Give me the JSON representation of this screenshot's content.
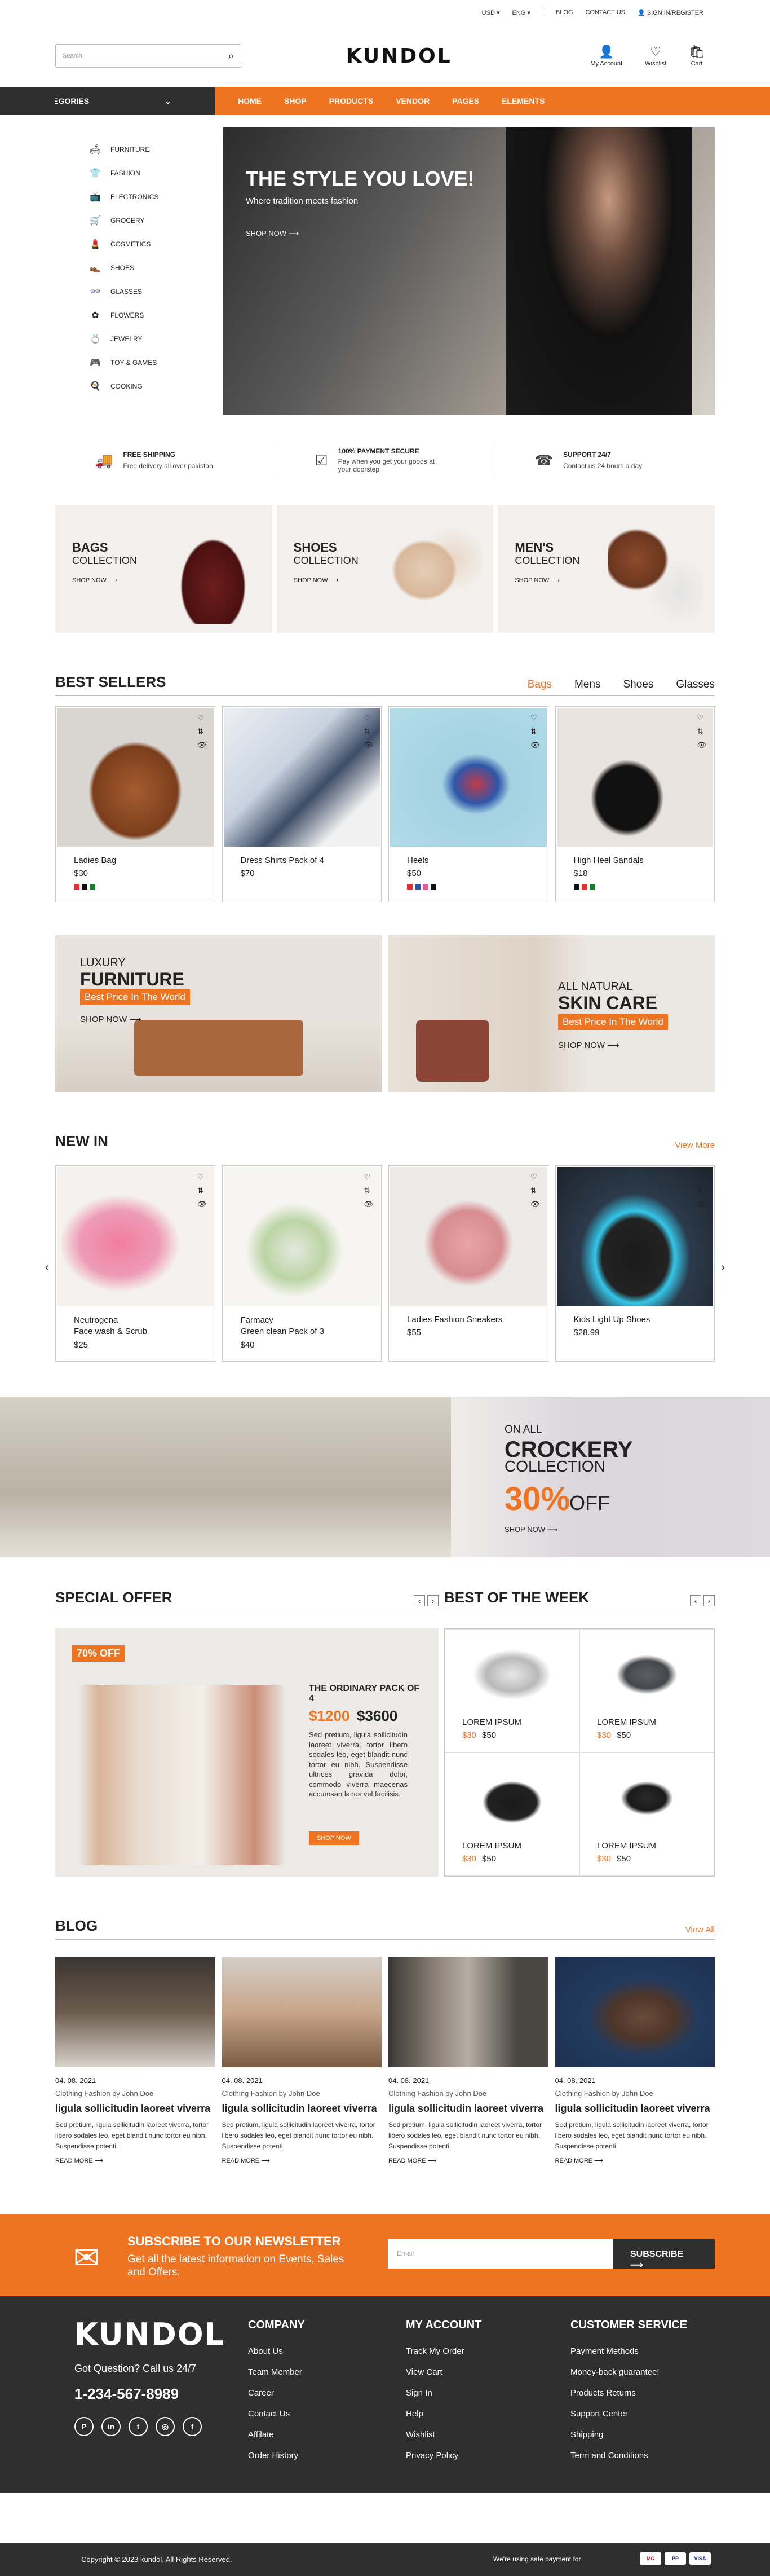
{
  "topbar": {
    "currency": "USD ▾",
    "language": "ENG ▾",
    "blog": "BLOG",
    "contact": "CONTACT US",
    "signin": "SIGN IN/REGISTER"
  },
  "header": {
    "search_placeholder": "Search",
    "logo": "KUNDOL",
    "account": "My Account",
    "wishlist": "Wishlist",
    "cart": "Cart"
  },
  "nav": {
    "categories": "CATEGORIES",
    "links": [
      "HOME",
      "SHOP",
      "PRODUCTS",
      "VENDOR",
      "PAGES",
      "ELEMENTS"
    ]
  },
  "sidebar": [
    "FURNITURE",
    "FASHION",
    "ELECTRONICS",
    "GROCERY",
    "COSMETICS",
    "SHOES",
    "GLASSES",
    "FLOWERS",
    "JEWELRY",
    "TOY & GAMES",
    "COOKING"
  ],
  "hero": {
    "title": "THE STYLE YOU LOVE!",
    "subtitle": "Where tradition meets fashion",
    "cta": "SHOP NOW ⟶"
  },
  "features": [
    {
      "title": "FREE SHIPPING",
      "text": "Free delivery all over pakistan"
    },
    {
      "title": "100% PAYMENT SECURE",
      "text": "Pay when you get your goods at your doorstep"
    },
    {
      "title": "SUPPORT 24/7",
      "text": "Contact us 24 hours a day"
    }
  ],
  "collections": [
    {
      "title": "BAGS",
      "sub": "COLLECTION",
      "cta": "SHOP NOW ⟶"
    },
    {
      "title": "SHOES",
      "sub": "COLLECTION",
      "cta": "SHOP NOW ⟶"
    },
    {
      "title": "MEN'S",
      "sub": "COLLECTION",
      "cta": "SHOP NOW ⟶"
    }
  ],
  "best_sellers": {
    "title": "BEST SELLERS",
    "tabs": [
      "Bags",
      "Mens",
      "Shoes",
      "Glasses"
    ],
    "products": [
      {
        "name": "Ladies Bag",
        "price": "$30"
      },
      {
        "name": "Dress Shirts Pack of 4",
        "price": "$70"
      },
      {
        "name": "Heels",
        "price": "$50"
      },
      {
        "name": "High Heel Sandals",
        "price": "$18"
      }
    ]
  },
  "promos": [
    {
      "line1": "LUXURY",
      "line2": "FURNITURE",
      "tag": "Best Price In The World",
      "cta": "SHOP NOW ⟶"
    },
    {
      "line1": "ALL NATURAL",
      "line2": "SKIN CARE",
      "tag": "Best Price In The World",
      "cta": "SHOP NOW ⟶"
    }
  ],
  "new_in": {
    "title": "NEW IN",
    "more": "View More",
    "products": [
      {
        "name": "Neutrogena\nFace wash & Scrub",
        "price": "$25"
      },
      {
        "name": "Farmacy\nGreen clean Pack of 3",
        "price": "$40"
      },
      {
        "name": "Ladies Fashion Sneakers",
        "price": "$55"
      },
      {
        "name": "Kids Light Up Shoes",
        "price": "$28.99"
      }
    ]
  },
  "crockery": {
    "l1": "ON ALL",
    "l2": "CROCKERY",
    "l3": "COLLECTION",
    "pct": "30%",
    "off": "OFF",
    "cta": "SHOP NOW ⟶"
  },
  "special": {
    "title": "SPECIAL OFFER",
    "badge": "70% OFF",
    "name": "THE ORDINARY PACK OF 4",
    "price": "$1200",
    "old": "$3600",
    "desc": "Sed pretium, ligula sollicitudin laoreet viverra, tortor libero sodales leo, eget blandit nunc tortor eu nibh. Suspendisse ultrices gravida dolor, commodo viverra maecenas accumsan lacus vel facilisis.",
    "cta": "SHOP NOW"
  },
  "best_week": {
    "title": "BEST OF THE WEEK",
    "items": [
      {
        "name": "LOREM IPSUM",
        "price": "$30",
        "old": "$50"
      },
      {
        "name": "LOREM IPSUM",
        "price": "$30",
        "old": "$50"
      },
      {
        "name": "LOREM IPSUM",
        "price": "$30",
        "old": "$50"
      },
      {
        "name": "LOREM IPSUM",
        "price": "$30",
        "old": "$50"
      }
    ]
  },
  "blog": {
    "title": "BLOG",
    "more": "View All",
    "posts": [
      {
        "date": "04. 08. 2021",
        "meta": "Clothing Fashion    by John Doe",
        "title": "ligula sollicitudin laoreet viverra",
        "text": "Sed pretium, ligula sollicitudin laoreet viverra, tortor libero sodales leo, eget blandit nunc tortor eu nibh. Suspendisse potenti.",
        "cta": "READ MORE ⟶"
      },
      {
        "date": "04. 08. 2021",
        "meta": "Clothing Fashion    by John Doe",
        "title": "ligula sollicitudin laoreet viverra",
        "text": "Sed pretium, ligula sollicitudin laoreet viverra, tortor libero sodales leo, eget blandit nunc tortor eu nibh. Suspendisse potenti.",
        "cta": "READ MORE ⟶"
      },
      {
        "date": "04. 08. 2021",
        "meta": "Clothing Fashion    by John Doe",
        "title": "ligula sollicitudin laoreet viverra",
        "text": "Sed pretium, ligula sollicitudin laoreet viverra, tortor libero sodales leo, eget blandit nunc tortor eu nibh. Suspendisse potenti.",
        "cta": "READ MORE ⟶"
      },
      {
        "date": "04. 08. 2021",
        "meta": "Clothing Fashion    by John Doe",
        "title": "ligula sollicitudin laoreet viverra",
        "text": "Sed pretium, ligula sollicitudin laoreet viverra, tortor libero sodales leo, eget blandit nunc tortor eu nibh. Suspendisse potenti.",
        "cta": "READ MORE ⟶"
      }
    ]
  },
  "newsletter": {
    "title": "SUBSCRIBE TO OUR NEWSLETTER",
    "text": "Get all the latest information on Events, Sales and Offers.",
    "placeholder": "Email",
    "button": "SUBSCRIBE ⟶"
  },
  "footer": {
    "logo": "KUNDOL",
    "question": "Got Question? Call us 24/7",
    "phone": "1-234-567-8989",
    "company": {
      "title": "COMPANY",
      "links": [
        "About Us",
        "Team Member",
        "Career",
        "Contact Us",
        "Affilate",
        "Order History"
      ]
    },
    "account": {
      "title": "MY ACCOUNT",
      "links": [
        "Track My Order",
        "View Cart",
        "Sign In",
        "Help",
        "Wishlist",
        "Privacy Policy"
      ]
    },
    "service": {
      "title": "CUSTOMER SERVICE",
      "links": [
        "Payment Methods",
        "Money-back guarantee!",
        "Products Returns",
        "Support Center",
        "Shipping",
        "Term and Conditions"
      ]
    },
    "copyright": "Copyright © 2023 kundol. All Rights Reserved.",
    "safe": "We're using safe payment for",
    "pay": [
      "MC",
      "PP",
      "VISA"
    ]
  },
  "colors": {
    "accent": "#ef7422",
    "dark": "#2f2f2f"
  }
}
